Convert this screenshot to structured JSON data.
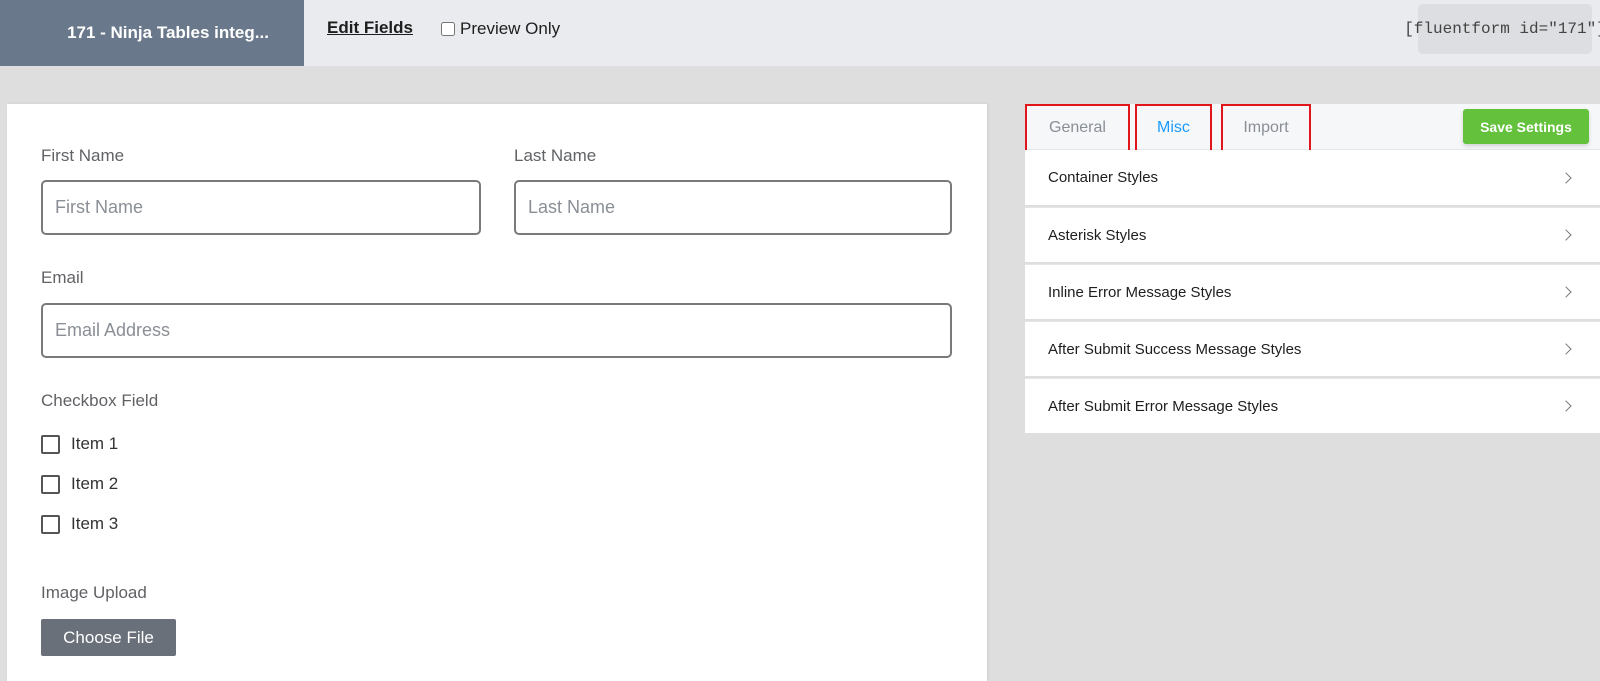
{
  "header": {
    "form_title": "171 - Ninja Tables integ...",
    "edit_fields_label": "Edit Fields",
    "preview_only_label": "Preview Only",
    "preview_only_checked": false,
    "shortcode": "[fluentform id=\"171\"]"
  },
  "form": {
    "first_name": {
      "label": "First Name",
      "placeholder": "First Name"
    },
    "last_name": {
      "label": "Last Name",
      "placeholder": "Last Name"
    },
    "email": {
      "label": "Email",
      "placeholder": "Email Address"
    },
    "checkbox_field": {
      "label": "Checkbox Field",
      "items": [
        "Item 1",
        "Item 2",
        "Item 3"
      ]
    },
    "image_upload": {
      "label": "Image Upload",
      "button_label": "Choose File"
    }
  },
  "settings": {
    "tabs": [
      "General",
      "Misc",
      "Import"
    ],
    "active_tab": "Misc",
    "save_button_label": "Save Settings",
    "sections": [
      "Container Styles",
      "Asterisk Styles",
      "Inline Error Message Styles",
      "After Submit Success Message Styles",
      "After Submit Error Message Styles"
    ]
  },
  "colors": {
    "title_bg": "#69788a",
    "active_tab": "#1a9bff",
    "highlight_border": "#e0161b",
    "save_button": "#63c13b"
  }
}
